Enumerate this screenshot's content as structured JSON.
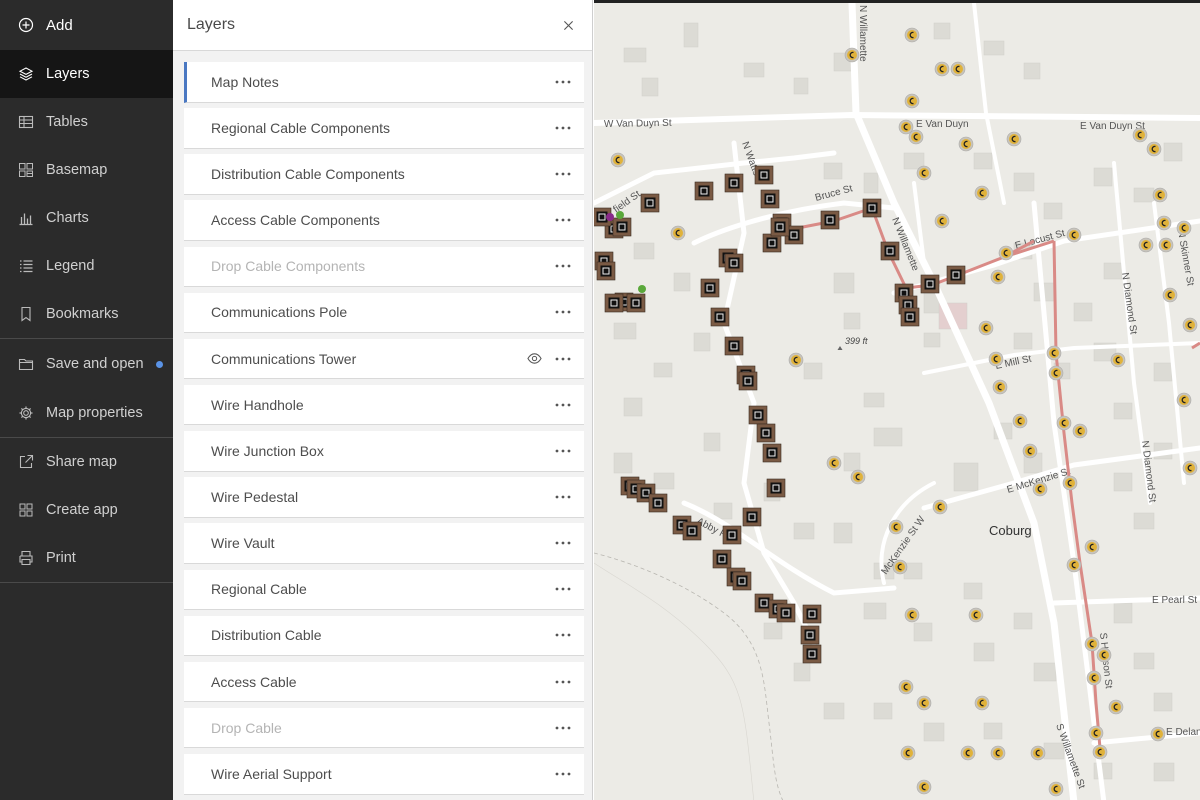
{
  "sidebar": {
    "items": [
      {
        "id": "add",
        "label": "Add",
        "icon": "plus-circle-icon"
      },
      {
        "id": "layers",
        "label": "Layers",
        "icon": "layers-icon"
      },
      {
        "id": "tables",
        "label": "Tables",
        "icon": "table-icon"
      },
      {
        "id": "basemap",
        "label": "Basemap",
        "icon": "basemap-icon"
      },
      {
        "id": "charts",
        "label": "Charts",
        "icon": "chart-icon"
      },
      {
        "id": "legend",
        "label": "Legend",
        "icon": "legend-icon"
      },
      {
        "id": "bookmarks",
        "label": "Bookmarks",
        "icon": "bookmark-icon"
      },
      {
        "id": "save_open",
        "label": "Save and open",
        "icon": "folder-icon"
      },
      {
        "id": "map_properties",
        "label": "Map properties",
        "icon": "gear-icon"
      },
      {
        "id": "share_map",
        "label": "Share map",
        "icon": "share-icon"
      },
      {
        "id": "create_app",
        "label": "Create app",
        "icon": "apps-icon"
      },
      {
        "id": "print",
        "label": "Print",
        "icon": "printer-icon"
      }
    ],
    "active": "layers",
    "unsaved_dot_color": "#5a93e6"
  },
  "panel": {
    "title": "Layers",
    "layers": [
      {
        "label": "Map Notes",
        "dim": false
      },
      {
        "label": "Regional Cable Components",
        "dim": false
      },
      {
        "label": "Distribution Cable Components",
        "dim": false
      },
      {
        "label": "Access Cable Components",
        "dim": false
      },
      {
        "label": "Drop Cable Components",
        "dim": true
      },
      {
        "label": "Communications Pole",
        "dim": false
      },
      {
        "label": "Communications Tower",
        "dim": false
      },
      {
        "label": "Wire Handhole",
        "dim": false
      },
      {
        "label": "Wire Junction Box",
        "dim": false
      },
      {
        "label": "Wire Pedestal",
        "dim": false
      },
      {
        "label": "Wire Vault",
        "dim": false
      },
      {
        "label": "Regional Cable",
        "dim": false
      },
      {
        "label": "Distribution Cable",
        "dim": false
      },
      {
        "label": "Access Cable",
        "dim": false
      },
      {
        "label": "Drop Cable",
        "dim": true
      },
      {
        "label": "Wire Aerial Support",
        "dim": false
      }
    ]
  },
  "map": {
    "town_label": "Coburg",
    "elevation_label": "399 ft",
    "streets": {
      "w_van_duyn": "W Van Duyn St",
      "e_van_duyn_1": "E Van Duyn",
      "e_van_duyn_2": "E Van Duyn St",
      "n_watts": "N Watts",
      "bruce": "Bruce St",
      "n_willamette_1": "N Willamette",
      "n_willamette_2": "N Willamette",
      "e_locust": "E Locust St",
      "n_diamond_1": "N Diamond St",
      "n_skinner": "N Skinner St",
      "e_mill": "E Mill St",
      "e_mckenzie": "E McKenzie St",
      "n_diamond_2": "N Diamond St",
      "mckenzie_w": "McKenzie St W",
      "abby": "Abby R",
      "e_pearl": "E Pearl St",
      "s_harrison": "S Harison St",
      "s_willamette": "S Willamette St",
      "e_delan": "E Delan",
      "field": "field St"
    },
    "colors": {
      "cable": "#d98a86",
      "point_gold": "#e0b23a",
      "box_fill": "#7a5a44"
    }
  }
}
